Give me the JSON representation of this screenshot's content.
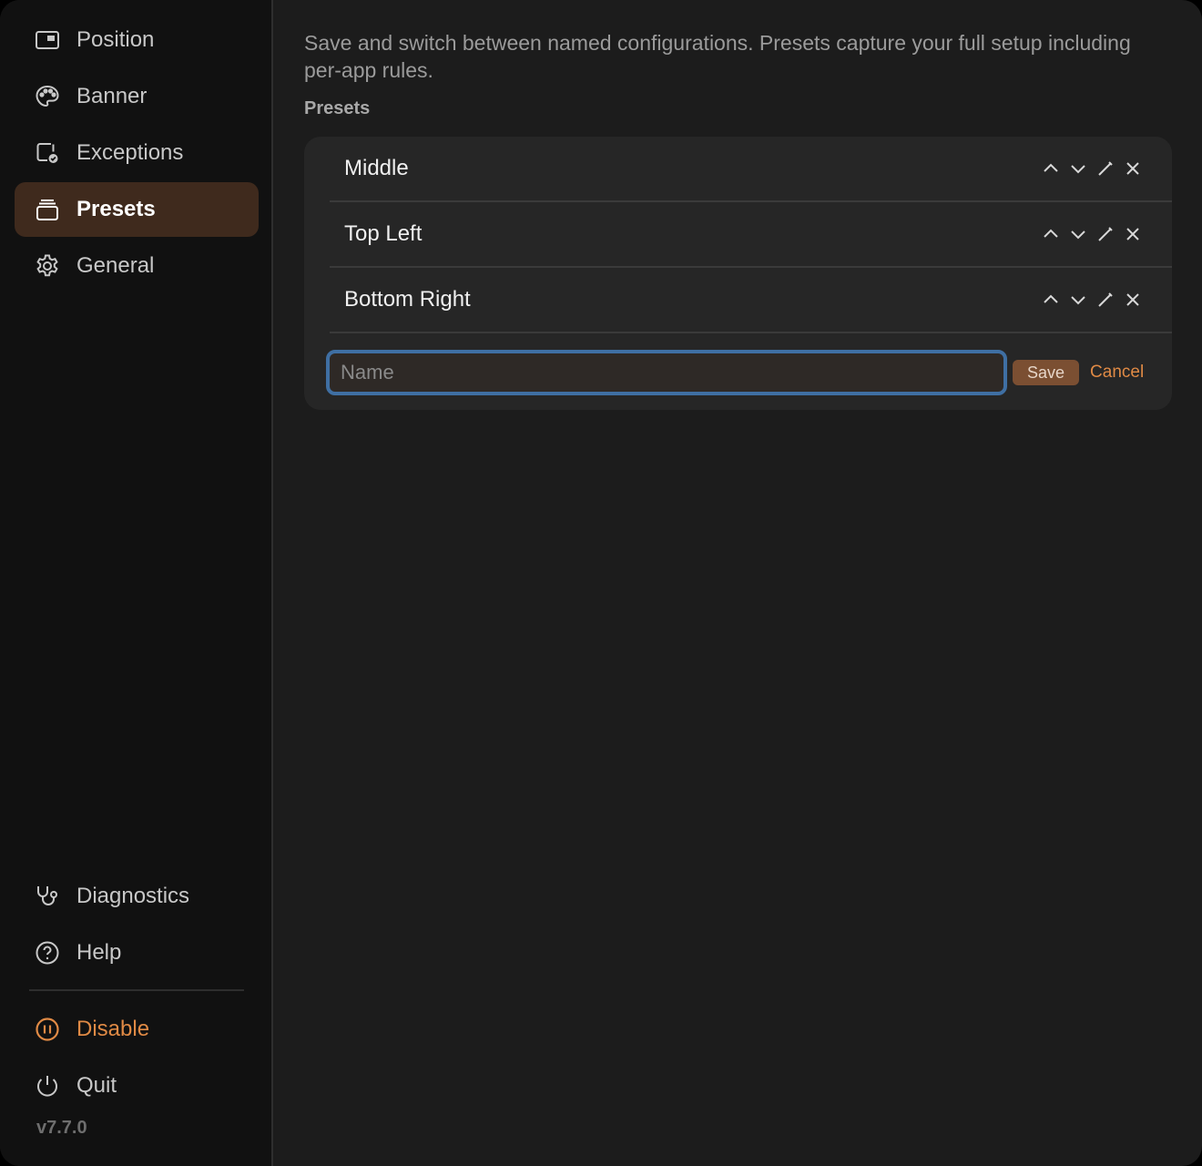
{
  "sidebar": {
    "items": [
      {
        "label": "Position",
        "icon": "window-position-icon"
      },
      {
        "label": "Banner",
        "icon": "palette-icon"
      },
      {
        "label": "Exceptions",
        "icon": "exception-check-icon"
      },
      {
        "label": "Presets",
        "icon": "stack-icon",
        "active": true
      },
      {
        "label": "General",
        "icon": "gear-icon"
      }
    ],
    "bottom": [
      {
        "label": "Diagnostics",
        "icon": "stethoscope-icon"
      },
      {
        "label": "Help",
        "icon": "help-circle-icon"
      },
      {
        "label": "Disable",
        "icon": "pause-circle-icon"
      },
      {
        "label": "Quit",
        "icon": "power-icon"
      }
    ],
    "version": "v7.7.0"
  },
  "main": {
    "description": "Save and switch between named configurations. Presets capture your full setup including per-app rules.",
    "section_label": "Presets",
    "presets": [
      {
        "name": "Middle"
      },
      {
        "name": "Top Left"
      },
      {
        "name": "Bottom Right"
      }
    ],
    "form": {
      "placeholder": "Name",
      "value": "",
      "save_label": "Save",
      "cancel_label": "Cancel"
    }
  },
  "colors": {
    "accent": "#e08a45",
    "active_bg": "#3f2a1d",
    "focus_ring": "#3f6fa3",
    "save_bg": "#7b4f32"
  }
}
